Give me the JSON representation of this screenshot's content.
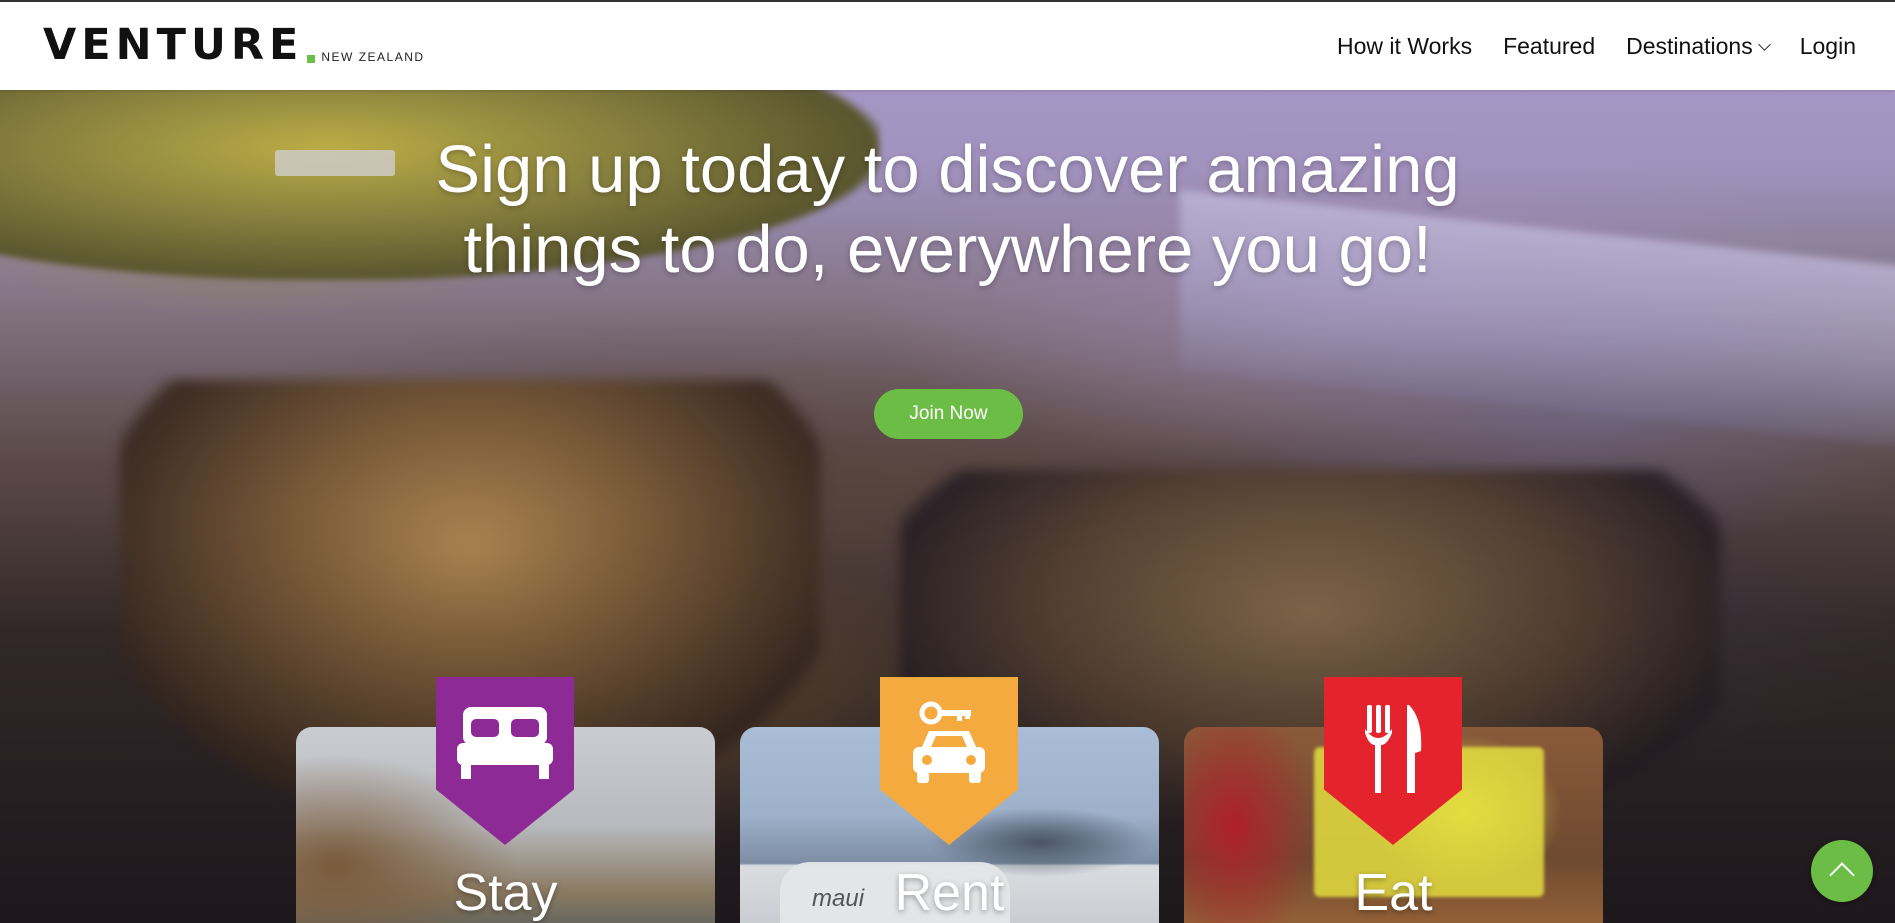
{
  "brand": {
    "name": "VENTURE",
    "region": "NEW ZEALAND",
    "accent_color": "#6cc04a"
  },
  "nav": {
    "items": [
      {
        "label": "How it Works"
      },
      {
        "label": "Featured"
      },
      {
        "label": "Destinations",
        "has_dropdown": true
      },
      {
        "label": "Login"
      }
    ]
  },
  "hero": {
    "headline_line1": "Sign up today to discover amazing",
    "headline_line2": "things to do, everywhere you go!",
    "cta_label": "Join Now",
    "cta_color": "#6cbd45"
  },
  "categories": [
    {
      "title": "Stay",
      "icon": "bed-icon",
      "color": "#8e2a95"
    },
    {
      "title": "Rent",
      "icon": "car-key-icon",
      "color": "#f4aa3f",
      "image_text": "maui"
    },
    {
      "title": "Eat",
      "icon": "fork-knife-icon",
      "color": "#e4232d"
    }
  ],
  "scroll_top": {
    "icon": "chevron-up-icon",
    "color": "#6cbd45"
  }
}
